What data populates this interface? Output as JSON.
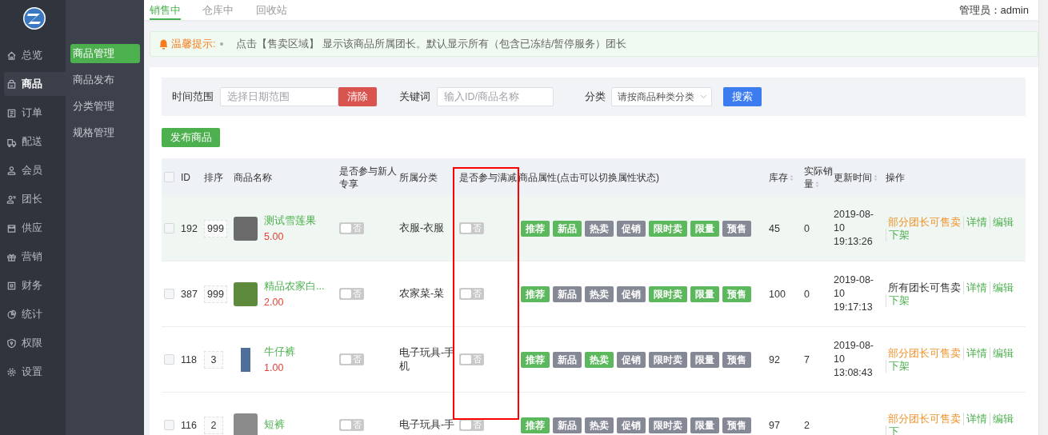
{
  "nav": {
    "items": [
      {
        "label": "总览",
        "selected": false
      },
      {
        "label": "商品",
        "selected": true
      },
      {
        "label": "订单",
        "selected": false
      },
      {
        "label": "配送",
        "selected": false
      },
      {
        "label": "会员",
        "selected": false
      },
      {
        "label": "团长",
        "selected": false
      },
      {
        "label": "供应",
        "selected": false
      },
      {
        "label": "营销",
        "selected": false
      },
      {
        "label": "财务",
        "selected": false
      },
      {
        "label": "统计",
        "selected": false
      },
      {
        "label": "权限",
        "selected": false
      },
      {
        "label": "设置",
        "selected": false
      }
    ]
  },
  "subnav": {
    "items": [
      {
        "label": "商品管理",
        "selected": true
      },
      {
        "label": "商品发布",
        "selected": false
      },
      {
        "label": "分类管理",
        "selected": false
      },
      {
        "label": "规格管理",
        "selected": false
      }
    ]
  },
  "tabs": [
    {
      "label": "销售中",
      "selected": true
    },
    {
      "label": "仓库中",
      "selected": false
    },
    {
      "label": "回收站",
      "selected": false
    }
  ],
  "admin": {
    "label": "管理员：",
    "name": "admin"
  },
  "notice": {
    "title": "温馨提示:",
    "text": "点击【售卖区域】 显示该商品所属团长。默认显示所有（包含已冻结/暂停服务）团长"
  },
  "filter": {
    "time_label": "时间范围",
    "time_placeholder": "选择日期范围",
    "clear": "清除",
    "keyword_label": "关键词",
    "keyword_placeholder": "输入ID/商品名称",
    "category_label": "分类",
    "category_value": "请按商品种类分类",
    "search": "搜索"
  },
  "publish_button": "发布商品",
  "select_all": {
    "checked": false
  },
  "table": {
    "columns": [
      {
        "label": "ID",
        "sortable": false
      },
      {
        "label": "排序",
        "sortable": false
      },
      {
        "label": "商品名称",
        "sortable": false
      },
      {
        "label": "是否参与新人专享",
        "sortable": false
      },
      {
        "label": "所属分类",
        "sortable": false
      },
      {
        "label": "是否参与满减",
        "sortable": false
      },
      {
        "label": "商品属性(点击可以切换属性状态)",
        "sortable": false
      },
      {
        "label": "库存",
        "sortable": true
      },
      {
        "label": "实际销量",
        "sortable": true
      },
      {
        "label": "更新时间",
        "sortable": true
      },
      {
        "label": "操作",
        "sortable": false
      }
    ],
    "rows": [
      {
        "checked": false,
        "highlighted": true,
        "id": "192",
        "sort": "999",
        "name": "测试雪莲果",
        "price": "5.00",
        "newcomer": {
          "label": "否",
          "on": false
        },
        "category": "衣服-衣服",
        "discount": {
          "label": "否",
          "on": false
        },
        "tags": [
          {
            "label": "推荐",
            "on": true
          },
          {
            "label": "新品",
            "on": true
          },
          {
            "label": "热卖",
            "on": false
          },
          {
            "label": "促销",
            "on": false
          },
          {
            "label": "限时卖",
            "on": true
          },
          {
            "label": "限量",
            "on": true
          },
          {
            "label": "预售",
            "on": false
          }
        ],
        "stock": "45",
        "sales": "0",
        "updated": "2019-08-10 19:13:26",
        "sale_scope": {
          "label": "部分团长可售卖",
          "kind": "partial"
        },
        "actions": [
          "详情",
          "编辑",
          "下架"
        ]
      },
      {
        "checked": false,
        "highlighted": false,
        "id": "387",
        "sort": "999",
        "name": "精品农家白...",
        "price": "2.00",
        "newcomer": {
          "label": "否",
          "on": false
        },
        "category": "农家菜-菜",
        "discount": {
          "label": "否",
          "on": false
        },
        "tags": [
          {
            "label": "推荐",
            "on": true
          },
          {
            "label": "新品",
            "on": false
          },
          {
            "label": "热卖",
            "on": false
          },
          {
            "label": "促销",
            "on": false
          },
          {
            "label": "限时卖",
            "on": true
          },
          {
            "label": "限量",
            "on": true
          },
          {
            "label": "预售",
            "on": true
          }
        ],
        "stock": "100",
        "sales": "0",
        "updated": "2019-08-10 19:17:13",
        "sale_scope": {
          "label": "所有团长可售卖",
          "kind": "all"
        },
        "actions": [
          "详情",
          "编辑",
          "下架"
        ]
      },
      {
        "checked": false,
        "highlighted": false,
        "id": "118",
        "sort": "3",
        "name": "牛仔裤",
        "price": "1.00",
        "newcomer": {
          "label": "否",
          "on": false
        },
        "category": "电子玩具-手机",
        "discount": {
          "label": "否",
          "on": false
        },
        "tags": [
          {
            "label": "推荐",
            "on": true
          },
          {
            "label": "新品",
            "on": false
          },
          {
            "label": "热卖",
            "on": true
          },
          {
            "label": "促销",
            "on": false
          },
          {
            "label": "限时卖",
            "on": false
          },
          {
            "label": "限量",
            "on": false
          },
          {
            "label": "预售",
            "on": false
          }
        ],
        "stock": "92",
        "sales": "7",
        "updated": "2019-08-10 13:08:43",
        "sale_scope": {
          "label": "部分团长可售卖",
          "kind": "partial"
        },
        "actions": [
          "详情",
          "编辑",
          "下架"
        ]
      },
      {
        "checked": false,
        "highlighted": false,
        "id": "116",
        "sort": "2",
        "name": "短裤",
        "price": "",
        "newcomer": {
          "label": "否",
          "on": false
        },
        "category": "电子玩具-手",
        "discount": {
          "label": "否",
          "on": false
        },
        "tags": [
          {
            "label": "推荐",
            "on": true
          },
          {
            "label": "新品",
            "on": false
          },
          {
            "label": "热卖",
            "on": false
          },
          {
            "label": "促销",
            "on": false
          },
          {
            "label": "限时卖",
            "on": false
          },
          {
            "label": "限量",
            "on": false
          },
          {
            "label": "预售",
            "on": false
          }
        ],
        "stock": "97",
        "sales": "2",
        "updated": "",
        "sale_scope": {
          "label": "部分团长可售卖",
          "kind": "partial"
        },
        "actions": [
          "详情",
          "编辑",
          "下"
        ]
      }
    ]
  }
}
